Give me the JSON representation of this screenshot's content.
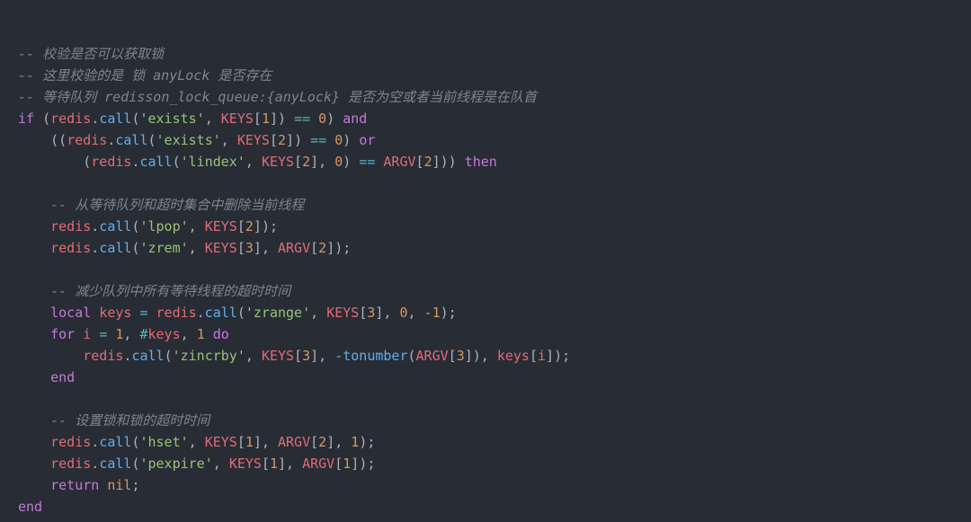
{
  "code": {
    "c1": "-- 校验是否可以获取锁",
    "c2": "-- 这里校验的是 锁 anyLock 是否存在",
    "c3": "-- 等待队列 redisson_lock_queue:{anyLock} 是否为空或者当前线程是在队首",
    "l4": {
      "if": "if",
      "p1": "(",
      "redis": "redis",
      "dot": ".",
      "call": "call",
      "p2": "(",
      "s": "'exists'",
      "cm": ", ",
      "keys": "KEYS",
      "lb": "[",
      "idx": "1",
      "rb": "]",
      "p3": ") ",
      "eq": "==",
      "sp": " ",
      "zero": "0",
      "p4": ") ",
      "and": "and"
    },
    "l5": {
      "sp": "    ",
      "p1": "((",
      "redis": "redis",
      "dot": ".",
      "call": "call",
      "p2": "(",
      "s": "'exists'",
      "cm": ", ",
      "keys": "KEYS",
      "lb": "[",
      "idx": "2",
      "rb": "]",
      "p3": ") ",
      "eq": "==",
      "sp2": " ",
      "zero": "0",
      "p4": ") ",
      "or": "or"
    },
    "l6": {
      "sp": "        ",
      "p1": "(",
      "redis": "redis",
      "dot": ".",
      "call": "call",
      "p2": "(",
      "s": "'lindex'",
      "cm": ", ",
      "keys": "KEYS",
      "lb": "[",
      "idx": "2",
      "rb": "]",
      "cm2": ", ",
      "zero": "0",
      "p3": ") ",
      "eq": "==",
      "sp2": " ",
      "argv": "ARGV",
      "lb2": "[",
      "idx2": "2",
      "rb2": "]",
      "p4": ")) ",
      "then": "then"
    },
    "l7": "",
    "c4": "    -- 从等待队列和超时集合中删除当前线程",
    "l9": {
      "sp": "    ",
      "redis": "redis",
      "dot": ".",
      "call": "call",
      "p1": "(",
      "s": "'lpop'",
      "cm": ", ",
      "keys": "KEYS",
      "lb": "[",
      "idx": "2",
      "rb": "]",
      "p2": ");"
    },
    "l10": {
      "sp": "    ",
      "redis": "redis",
      "dot": ".",
      "call": "call",
      "p1": "(",
      "s": "'zrem'",
      "cm": ", ",
      "keys": "KEYS",
      "lb": "[",
      "idx": "3",
      "rb": "]",
      "cm2": ", ",
      "argv": "ARGV",
      "lb2": "[",
      "idx2": "2",
      "rb2": "]",
      "p2": ");"
    },
    "l11": "",
    "c5": "    -- 减少队列中所有等待线程的超时时间",
    "l13": {
      "sp": "    ",
      "local": "local",
      "sp2": " ",
      "var": "keys",
      "sp3": " ",
      "eq": "=",
      "sp4": " ",
      "redis": "redis",
      "dot": ".",
      "call": "call",
      "p1": "(",
      "s": "'zrange'",
      "cm": ", ",
      "keys2": "KEYS",
      "lb": "[",
      "idx": "3",
      "rb": "]",
      "cm2": ", ",
      "zero": "0",
      "cm3": ", ",
      "neg1": "-1",
      "p2": ");"
    },
    "l14": {
      "sp": "    ",
      "for": "for",
      "sp2": " ",
      "i": "i",
      "sp3": " ",
      "eq": "=",
      "sp4": " ",
      "one": "1",
      "cm": ", ",
      "hash": "#",
      "keys": "keys",
      "cm2": ", ",
      "one2": "1",
      "sp5": " ",
      "do": "do"
    },
    "l15": {
      "sp": "        ",
      "redis": "redis",
      "dot": ".",
      "call": "call",
      "p1": "(",
      "s": "'zincrby'",
      "cm": ", ",
      "keys": "KEYS",
      "lb": "[",
      "idx": "3",
      "rb": "]",
      "cm2": ", ",
      "neg": "-",
      "ton": "tonumber",
      "p2": "(",
      "argv": "ARGV",
      "lb2": "[",
      "idx2": "3",
      "rb2": "]",
      "p3": "), ",
      "keysv": "keys",
      "lb3": "[",
      "i": "i",
      "rb3": "]",
      "p4": ");"
    },
    "l16": {
      "sp": "    ",
      "end": "end"
    },
    "l17": "",
    "c6": "    -- 设置锁和锁的超时时间",
    "l19": {
      "sp": "    ",
      "redis": "redis",
      "dot": ".",
      "call": "call",
      "p1": "(",
      "s": "'hset'",
      "cm": ", ",
      "keys": "KEYS",
      "lb": "[",
      "idx": "1",
      "rb": "]",
      "cm2": ", ",
      "argv": "ARGV",
      "lb2": "[",
      "idx2": "2",
      "rb2": "]",
      "cm3": ", ",
      "one": "1",
      "p2": ");"
    },
    "l20": {
      "sp": "    ",
      "redis": "redis",
      "dot": ".",
      "call": "call",
      "p1": "(",
      "s": "'pexpire'",
      "cm": ", ",
      "keys": "KEYS",
      "lb": "[",
      "idx": "1",
      "rb": "]",
      "cm2": ", ",
      "argv": "ARGV",
      "lb2": "[",
      "idx2": "1",
      "rb2": "]",
      "p2": ");"
    },
    "l21": {
      "sp": "    ",
      "return": "return",
      "sp2": " ",
      "nil": "nil",
      "sc": ";"
    },
    "l22": {
      "end": "end"
    }
  }
}
